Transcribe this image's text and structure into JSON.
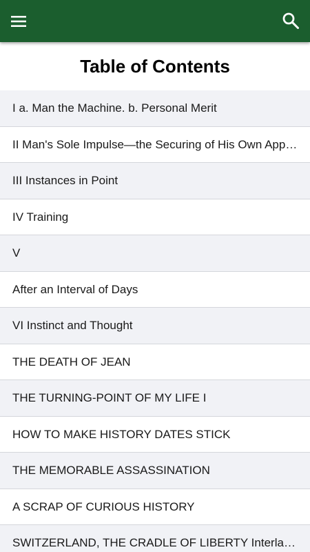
{
  "colors": {
    "toolbar": "#1b5e2e",
    "row_alt": "#f1f2f6",
    "row": "#ffffff",
    "icon": "#ffffff"
  },
  "toolbar": {
    "menu_icon": "hamburger-menu-icon",
    "search_icon": "search-icon"
  },
  "page": {
    "title": "Table of Contents"
  },
  "toc": {
    "items": [
      {
        "label": "I a. Man the Machine. b. Personal Merit"
      },
      {
        "label": "II Man's Sole Impulse—the Securing of His Own Approval"
      },
      {
        "label": "III Instances in Point"
      },
      {
        "label": "IV Training"
      },
      {
        "label": "V"
      },
      {
        "label": "After an Interval of Days"
      },
      {
        "label": "VI Instinct and Thought"
      },
      {
        "label": "THE DEATH OF JEAN"
      },
      {
        "label": "THE TURNING-POINT OF MY LIFE I"
      },
      {
        "label": "HOW TO MAKE HISTORY DATES STICK"
      },
      {
        "label": "THE MEMORABLE ASSASSINATION"
      },
      {
        "label": "A SCRAP OF CURIOUS HISTORY"
      },
      {
        "label": "SWITZERLAND, THE CRADLE OF LIBERTY Interlaken"
      }
    ]
  }
}
